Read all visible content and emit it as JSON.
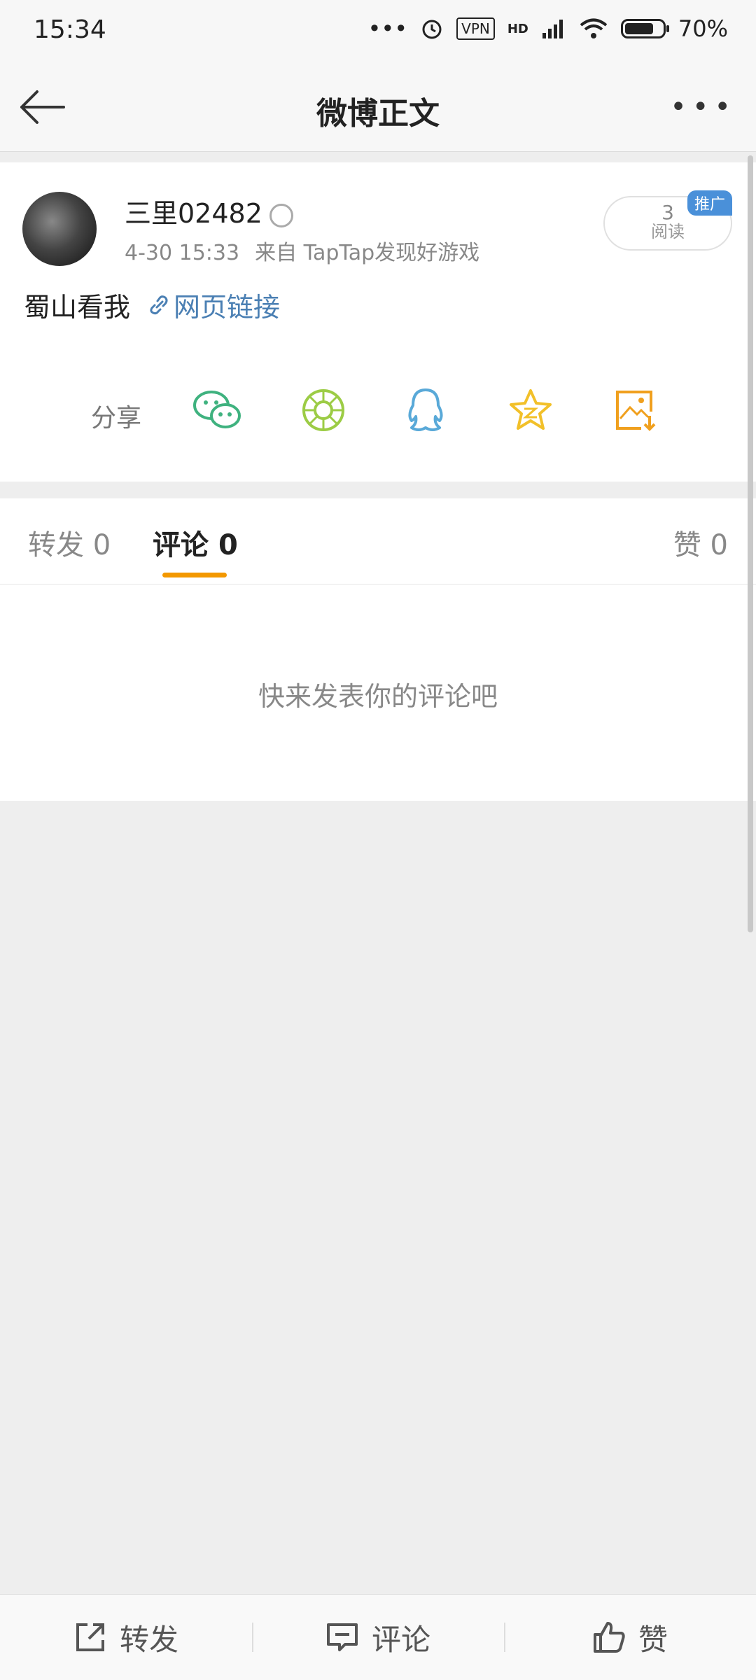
{
  "status_bar": {
    "time": "15:34",
    "dots": "•••",
    "vpn": "VPN",
    "signal": "HD",
    "battery_percent": "70%"
  },
  "header": {
    "title": "微博正文",
    "more": "•••"
  },
  "post": {
    "username": "三里02482",
    "date": "4-30 15:33",
    "source": "来自 TapTap发现好游戏",
    "read_count": "3",
    "read_label": "阅读",
    "promo_tag": "推广",
    "text": "蜀山看我",
    "link_text": "网页链接"
  },
  "share": {
    "label": "分享",
    "icons": [
      "wechat-icon",
      "moments-icon",
      "qq-icon",
      "qzone-icon",
      "save-image-icon"
    ]
  },
  "tabs": [
    {
      "label": "转发",
      "count": "0"
    },
    {
      "label": "评论",
      "count": "0"
    },
    {
      "label": "赞",
      "count": "0"
    }
  ],
  "comments": {
    "empty_hint": "快来发表你的评论吧"
  },
  "bottom_bar": {
    "repost": "转发",
    "comment": "评论",
    "like": "赞"
  },
  "colors": {
    "accent": "#f39800",
    "link": "#4a7fb3",
    "wechat": "#3fb27f",
    "moments": "#9ccc45",
    "qq": "#59a9d8",
    "qzone": "#f2c029",
    "save": "#f0a01e"
  }
}
